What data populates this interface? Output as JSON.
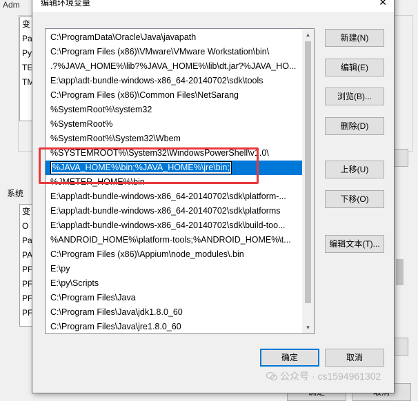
{
  "background": {
    "title_fragment": "Adm",
    "user_items": [
      "变",
      "Pa",
      "Py",
      "TE",
      "TM"
    ],
    "system_group_label": "系统",
    "system_items": [
      "变",
      "O",
      "Pa",
      "PA",
      "PF",
      "PF",
      "PF",
      "PF"
    ],
    "bottom_button_fragment": "确定"
  },
  "dialog": {
    "title": "编辑环境变量",
    "close_glyph": "✕"
  },
  "list": {
    "items_before": [
      "C:\\ProgramData\\Oracle\\Java\\javapath",
      "C:\\Program Files (x86)\\VMware\\VMware Workstation\\bin\\",
      ".?%JAVA_HOME%\\lib?%JAVA_HOME%\\lib\\dt.jar?%JAVA_HO...",
      "E:\\app\\adt-bundle-windows-x86_64-20140702\\sdk\\tools",
      "C:\\Program Files (x86)\\Common Files\\NetSarang",
      "%SystemRoot%\\system32",
      "%SystemRoot%",
      "%SystemRoot%\\System32\\Wbem",
      "%SYSTEMROOT%\\System32\\WindowsPowerShell\\v1.0\\"
    ],
    "editing_value": "%JAVA_HOME%\\bin;%JAVA_HOME%\\jre\\bin;",
    "items_after": [
      "%JMETER_HOME%\\bin",
      "E:\\app\\adt-bundle-windows-x86_64-20140702\\sdk\\platform-...",
      "E:\\app\\adt-bundle-windows-x86_64-20140702\\sdk\\platforms",
      "E:\\app\\adt-bundle-windows-x86_64-20140702\\sdk\\build-too...",
      "%ANDROID_HOME%\\platform-tools;%ANDROID_HOME%\\t...",
      "C:\\Program Files (x86)\\Appium\\node_modules\\.bin",
      "E:\\py",
      "E:\\py\\Scripts",
      "C:\\Program Files\\Java",
      "C:\\Program Files\\Java\\jdk1.8.0_60",
      "C:\\Program Files\\Java\\jre1.8.0_60"
    ]
  },
  "buttons": {
    "new": "新建(N)",
    "edit": "编辑(E)",
    "browse": "浏览(B)...",
    "delete": "删除(D)",
    "move_up": "上移(U)",
    "move_down": "下移(O)",
    "edit_text": "编辑文本(T)...",
    "ok": "确定",
    "cancel": "取消",
    "bottom_cancel_fragment": "取消"
  },
  "watermark": "公众号 · cs1594961302",
  "colors": {
    "selection": "#0078d7",
    "annotation_red": "#e8383b"
  }
}
